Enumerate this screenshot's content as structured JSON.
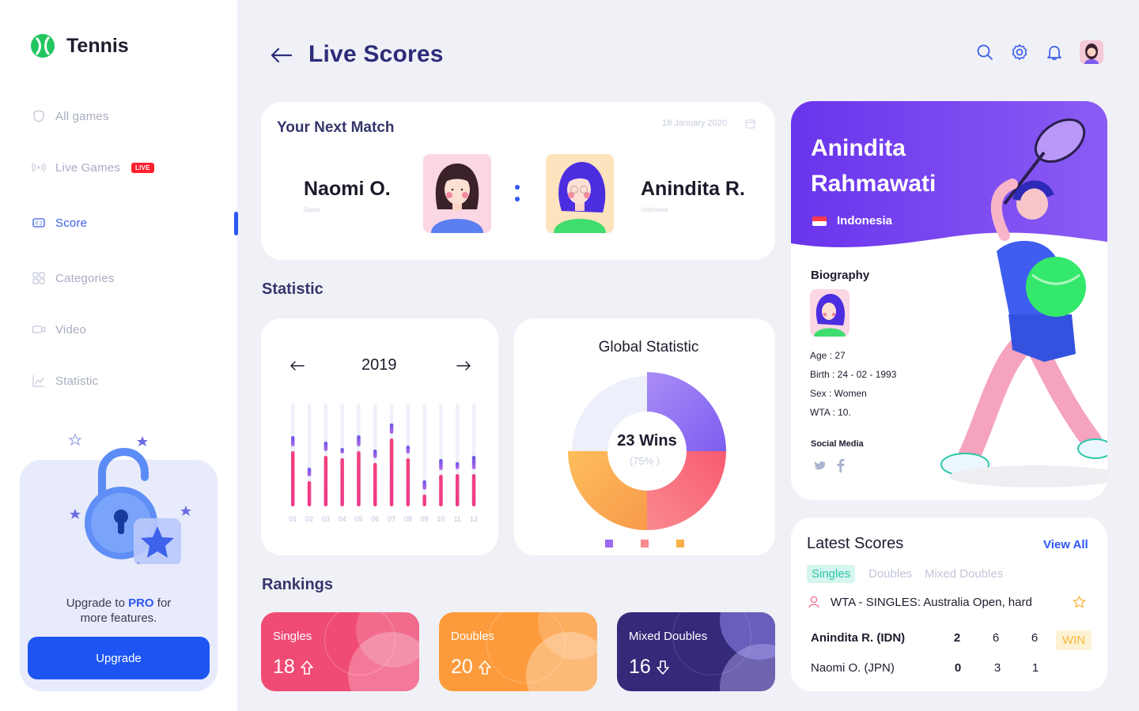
{
  "app": {
    "name": "Tennis"
  },
  "sidebar": {
    "items": [
      {
        "label": "All games",
        "icon": "shield-icon"
      },
      {
        "label": "Live Games",
        "icon": "broadcast-icon",
        "badge": "LIVE"
      },
      {
        "label": "Score",
        "icon": "scoreboard-icon",
        "active": true
      },
      {
        "label": "Categories",
        "icon": "grid-icon"
      },
      {
        "label": "Video",
        "icon": "video-icon"
      },
      {
        "label": "Statistic",
        "icon": "chart-icon"
      }
    ],
    "promo": {
      "text_before": "Upgrade to ",
      "highlight": "PRO",
      "text_after": " for",
      "line2": "more features.",
      "button": "Upgrade"
    }
  },
  "header": {
    "title": "Live Scores"
  },
  "next_match": {
    "title": "Your Next Match",
    "date": "18 January 2020",
    "player1": {
      "name": "Naomi O.",
      "country": "Japan"
    },
    "player2": {
      "name": "Anindita R.",
      "country": "Indonesia"
    }
  },
  "statistic": {
    "section_title": "Statistic",
    "year": "2019",
    "months": [
      "01",
      "02",
      "03",
      "04",
      "05",
      "06",
      "07",
      "08",
      "09",
      "10",
      "11",
      "12"
    ],
    "global_title": "Global Statistic",
    "wins_label": "23 Wins",
    "wins_pct": "(75% )"
  },
  "chart_data": [
    {
      "type": "bar",
      "title": "2019",
      "categories": [
        "01",
        "02",
        "03",
        "04",
        "05",
        "06",
        "07",
        "08",
        "09",
        "10",
        "11",
        "12"
      ],
      "series": [
        {
          "values": [
            13,
            11,
            12,
            7,
            14,
            11,
            13,
            10,
            12,
            14,
            9,
            17
          ]
        },
        {
          "values": [
            70,
            32,
            64,
            61,
            70,
            55,
            86,
            61,
            15,
            40,
            41,
            41
          ]
        }
      ],
      "ylim": [
        0,
        130
      ]
    },
    {
      "type": "pie",
      "title": "Global Statistic",
      "slices": [
        {
          "value": 25,
          "color": "#9b6cf2"
        },
        {
          "value": 25,
          "color": "#f2607a"
        },
        {
          "value": 25,
          "color": "#fbb04a"
        },
        {
          "value": 25,
          "color": "#edf0fb"
        }
      ]
    }
  ],
  "rankings": {
    "title": "Rankings",
    "cards": [
      {
        "label": "Singles",
        "value": "18",
        "trend": "up"
      },
      {
        "label": "Doubles",
        "value": "20",
        "trend": "up"
      },
      {
        "label": "Mixed Doubles",
        "value": "16",
        "trend": "down"
      }
    ]
  },
  "profile": {
    "first_name": "Anindita",
    "last_name": "Rahmawati",
    "country": "Indonesia",
    "bio_title": "Biography",
    "age": "Age : 27",
    "birth": "Birth : 24 - 02 - 1993",
    "sex": "Sex : Women",
    "wta": "WTA : 10.",
    "social_title": "Social Media"
  },
  "latest_scores": {
    "title": "Latest Scores",
    "view_all": "View All",
    "tabs": [
      "Singles",
      "Doubles",
      "Mixed Doubles"
    ],
    "tournament": "WTA - SINGLES: Australia Open, hard",
    "rows": [
      {
        "player": "Anindita R. (IDN)",
        "sets": [
          "2",
          "6",
          "6"
        ],
        "badge": "WIN"
      },
      {
        "player": "Naomi O. (JPN)",
        "sets": [
          "0",
          "3",
          "1"
        ]
      }
    ]
  },
  "colors": {
    "accent": "#1d55f3",
    "title": "#2c2c7a",
    "live": "#ff1f2d",
    "singles": "#f04b74",
    "doubles": "#fd9b3c",
    "mixed": "#35297a",
    "win_bg": "#fdf3d4",
    "win_text": "#f7b73a"
  }
}
